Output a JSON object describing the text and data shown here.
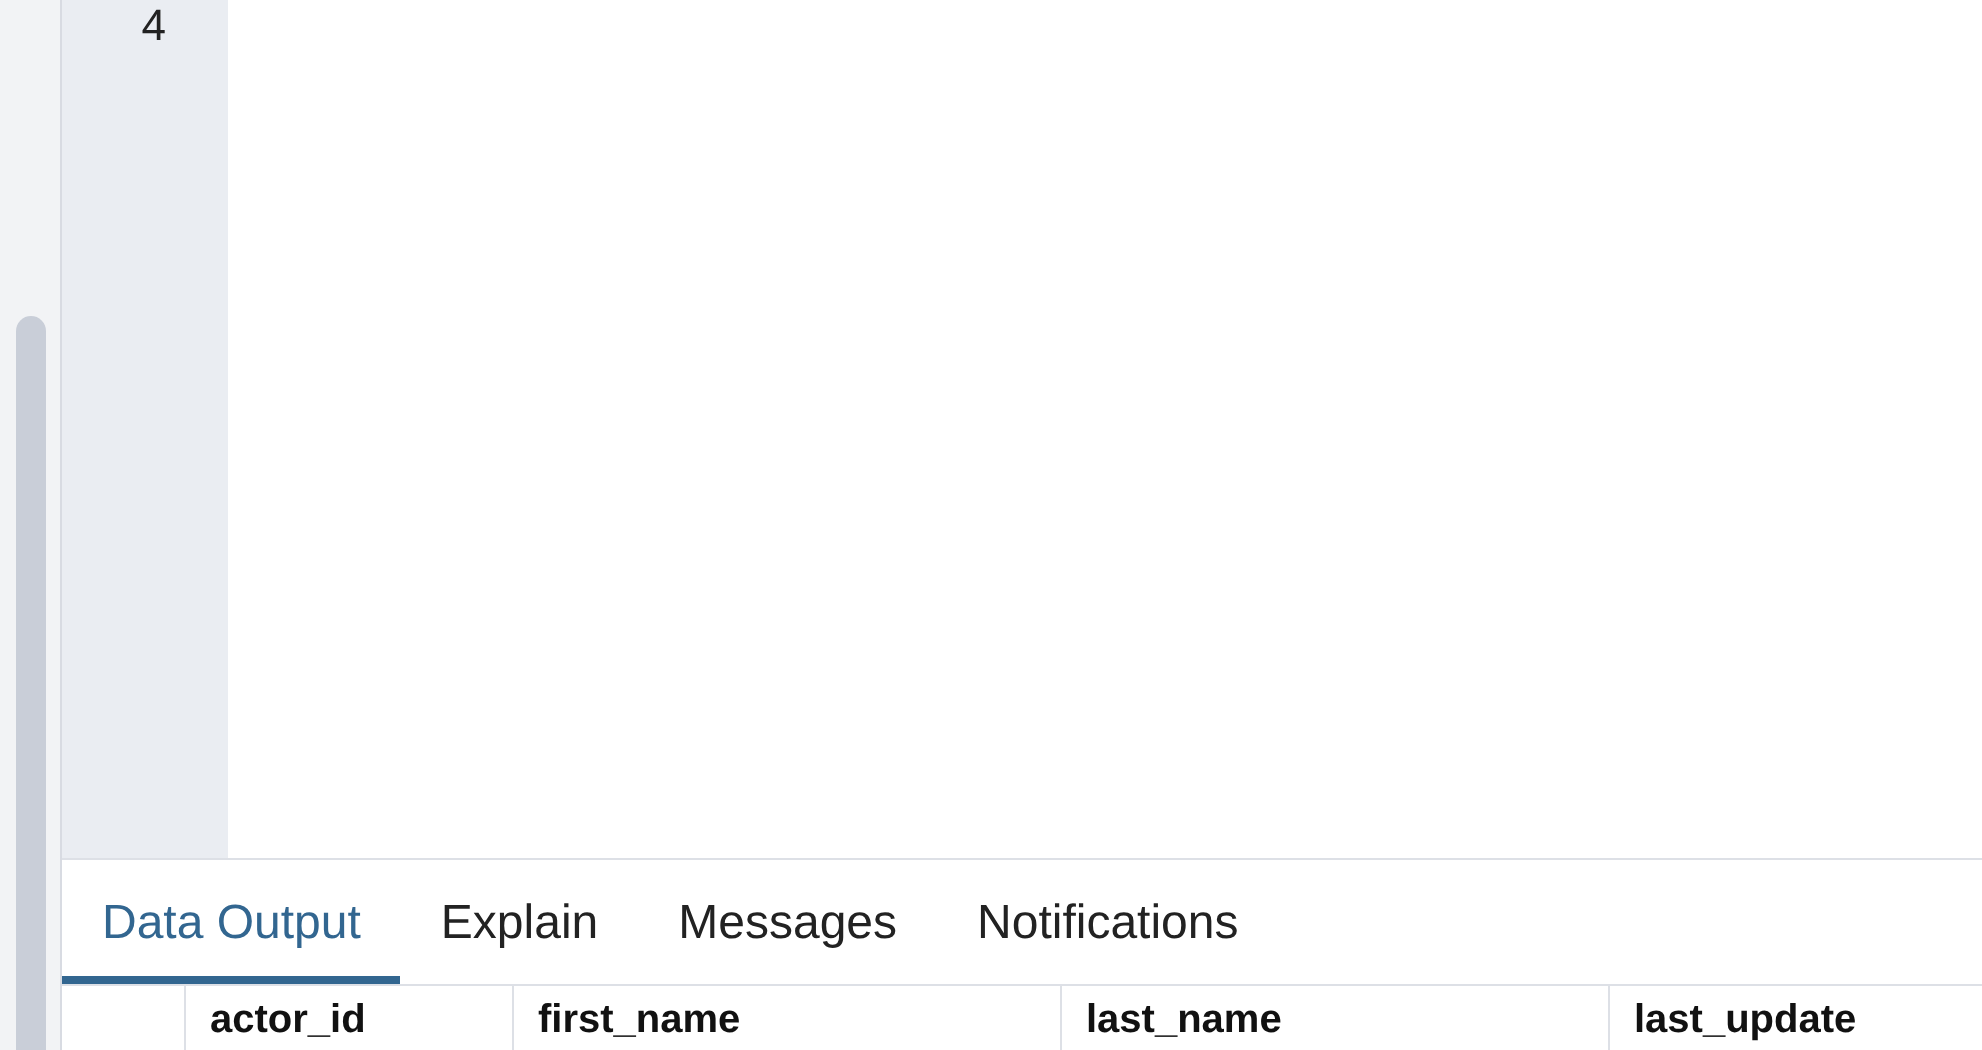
{
  "editor": {
    "line_numbers": [
      "4"
    ]
  },
  "result_tabs": [
    {
      "label": "Data Output",
      "selected": true
    },
    {
      "label": "Explain",
      "selected": false
    },
    {
      "label": "Messages",
      "selected": false
    },
    {
      "label": "Notifications",
      "selected": false
    }
  ],
  "table": {
    "columns": [
      "actor_id",
      "first_name",
      "last_name",
      "last_update"
    ]
  }
}
